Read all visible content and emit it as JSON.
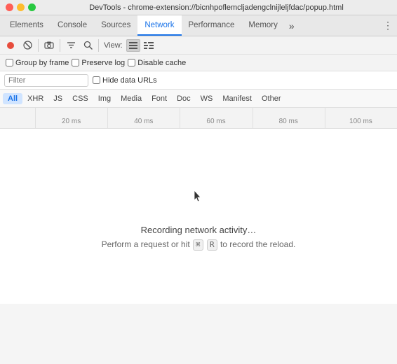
{
  "window": {
    "title": "DevTools - chrome-extension://bicnhpoflemcljadengclnijleljfdac/popup.html"
  },
  "titlebar": {
    "buttons": [
      "close",
      "minimize",
      "maximize"
    ]
  },
  "tabs": [
    {
      "id": "elements",
      "label": "Elements",
      "active": false
    },
    {
      "id": "console",
      "label": "Console",
      "active": false
    },
    {
      "id": "sources",
      "label": "Sources",
      "active": false
    },
    {
      "id": "network",
      "label": "Network",
      "active": true
    },
    {
      "id": "performance",
      "label": "Performance",
      "active": false
    },
    {
      "id": "memory",
      "label": "Memory",
      "active": false
    }
  ],
  "toolbar1": {
    "view_label": "View:",
    "icons": {
      "record": "⏺",
      "stop": "⊘",
      "camera": "📷",
      "filter": "⊟",
      "search": "🔍"
    }
  },
  "toolbar2": {
    "checkboxes": [
      {
        "id": "group-by-frame",
        "label": "Group by frame",
        "checked": false
      },
      {
        "id": "preserve-log",
        "label": "Preserve log",
        "checked": false
      },
      {
        "id": "disable-cache",
        "label": "Disable cache",
        "checked": false
      }
    ]
  },
  "filterbar": {
    "input_placeholder": "Filter",
    "hide_data_urls_label": "Hide data URLs"
  },
  "type_filters": [
    {
      "id": "all",
      "label": "All",
      "active": true
    },
    {
      "id": "xhr",
      "label": "XHR",
      "active": false
    },
    {
      "id": "js",
      "label": "JS",
      "active": false
    },
    {
      "id": "css",
      "label": "CSS",
      "active": false
    },
    {
      "id": "img",
      "label": "Img",
      "active": false
    },
    {
      "id": "media",
      "label": "Media",
      "active": false
    },
    {
      "id": "font",
      "label": "Font",
      "active": false
    },
    {
      "id": "doc",
      "label": "Doc",
      "active": false
    },
    {
      "id": "ws",
      "label": "WS",
      "active": false
    },
    {
      "id": "manifest",
      "label": "Manifest",
      "active": false
    },
    {
      "id": "other",
      "label": "Other",
      "active": false
    }
  ],
  "timeline": {
    "labels": [
      "20 ms",
      "40 ms",
      "60 ms",
      "80 ms",
      "100 ms"
    ]
  },
  "main": {
    "message": "Recording network activity…",
    "sub_message": "Perform a request or hit",
    "sub_message2": "to record the reload.",
    "cmd_key": "⌘",
    "r_key": "R"
  }
}
